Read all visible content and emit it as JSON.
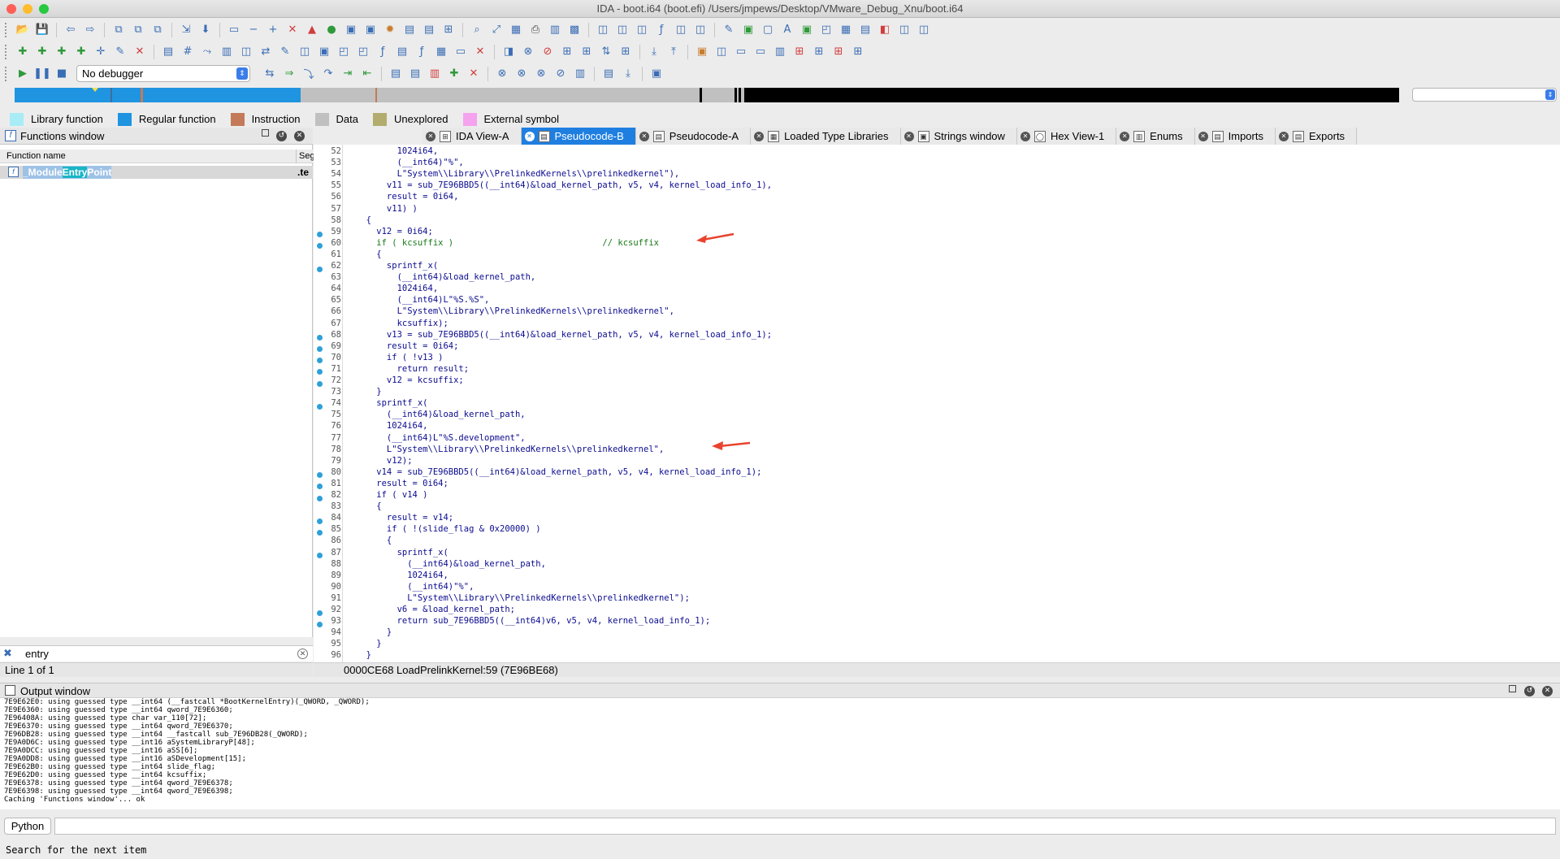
{
  "window": {
    "title": "IDA - boot.i64 (boot.efi) /Users/jmpews/Desktop/VMware_Debug_Xnu/boot.i64"
  },
  "debugger": {
    "selected": "No debugger"
  },
  "legend": [
    {
      "label": "Library function",
      "color": "#a8ecf6"
    },
    {
      "label": "Regular function",
      "color": "#1f94e0"
    },
    {
      "label": "Instruction",
      "color": "#c47a58"
    },
    {
      "label": "Data",
      "color": "#c0c0c0"
    },
    {
      "label": "Unexplored",
      "color": "#b2ad6e"
    },
    {
      "label": "External symbol",
      "color": "#f5a2ef"
    }
  ],
  "functions_window": {
    "title": "Functions window",
    "col_name": "Function name",
    "col_seg": "Seg",
    "rows": [
      {
        "name_pre": "_Module",
        "name_hl": "Entry",
        "name_post": "Point",
        "seg": ".te"
      }
    ],
    "filter_value": "entry",
    "status": "Line 1 of 1"
  },
  "tabs": [
    {
      "label": "IDA View-A",
      "icon": "graph-icon",
      "active": false
    },
    {
      "label": "Pseudocode-B",
      "icon": "pseudocode-icon",
      "active": true
    },
    {
      "label": "Pseudocode-A",
      "icon": "pseudocode-icon",
      "active": false
    },
    {
      "label": "Loaded Type Libraries",
      "icon": "library-icon",
      "active": false
    },
    {
      "label": "Strings window",
      "icon": "strings-icon",
      "active": false
    },
    {
      "label": "Hex View-1",
      "icon": "hex-icon",
      "active": false
    },
    {
      "label": "Enums",
      "icon": "enum-icon",
      "active": false
    },
    {
      "label": "Imports",
      "icon": "imports-icon",
      "active": false
    },
    {
      "label": "Exports",
      "icon": "exports-icon",
      "active": false
    }
  ],
  "code_lines": [
    {
      "n": "52",
      "bp": false,
      "t": "        1024i64,"
    },
    {
      "n": "53",
      "bp": false,
      "t": "        (__int64)\"%\","
    },
    {
      "n": "54",
      "bp": false,
      "t": "        L\"System\\\\Library\\\\PrelinkedKernels\\\\prelinkedkernel\"),"
    },
    {
      "n": "55",
      "bp": false,
      "t": "      v11 = sub_7E96BBD5((__int64)&load_kernel_path, v5, v4, kernel_load_info_1),"
    },
    {
      "n": "56",
      "bp": false,
      "t": "      result = 0i64,"
    },
    {
      "n": "57",
      "bp": false,
      "t": "      v11) )"
    },
    {
      "n": "58",
      "bp": false,
      "t": "  {"
    },
    {
      "n": "59",
      "bp": true,
      "t": "    v12 = 0i64;"
    },
    {
      "n": "60",
      "bp": true,
      "t": "    if ( kcsuffix )                             // kcsuffix"
    },
    {
      "n": "61",
      "bp": false,
      "t": "    {"
    },
    {
      "n": "62",
      "bp": true,
      "t": "      sprintf_x("
    },
    {
      "n": "63",
      "bp": false,
      "t": "        (__int64)&load_kernel_path,"
    },
    {
      "n": "64",
      "bp": false,
      "t": "        1024i64,"
    },
    {
      "n": "65",
      "bp": false,
      "t": "        (__int64)L\"%S.%S\","
    },
    {
      "n": "66",
      "bp": false,
      "t": "        L\"System\\\\Library\\\\PrelinkedKernels\\\\prelinkedkernel\","
    },
    {
      "n": "67",
      "bp": false,
      "t": "        kcsuffix);"
    },
    {
      "n": "68",
      "bp": true,
      "t": "      v13 = sub_7E96BBD5((__int64)&load_kernel_path, v5, v4, kernel_load_info_1);"
    },
    {
      "n": "69",
      "bp": true,
      "t": "      result = 0i64;"
    },
    {
      "n": "70",
      "bp": true,
      "t": "      if ( !v13 )"
    },
    {
      "n": "71",
      "bp": true,
      "t": "        return result;"
    },
    {
      "n": "72",
      "bp": true,
      "t": "      v12 = kcsuffix;"
    },
    {
      "n": "73",
      "bp": false,
      "t": "    }"
    },
    {
      "n": "74",
      "bp": true,
      "t": "    sprintf_x("
    },
    {
      "n": "75",
      "bp": false,
      "t": "      (__int64)&load_kernel_path,"
    },
    {
      "n": "76",
      "bp": false,
      "t": "      1024i64,"
    },
    {
      "n": "77",
      "bp": false,
      "t": "      (__int64)L\"%S.development\","
    },
    {
      "n": "78",
      "bp": false,
      "t": "      L\"System\\\\Library\\\\PrelinkedKernels\\\\prelinkedkernel\","
    },
    {
      "n": "79",
      "bp": false,
      "t": "      v12);"
    },
    {
      "n": "80",
      "bp": true,
      "t": "    v14 = sub_7E96BBD5((__int64)&load_kernel_path, v5, v4, kernel_load_info_1);"
    },
    {
      "n": "81",
      "bp": true,
      "t": "    result = 0i64;"
    },
    {
      "n": "82",
      "bp": true,
      "t": "    if ( v14 )"
    },
    {
      "n": "83",
      "bp": false,
      "t": "    {"
    },
    {
      "n": "84",
      "bp": true,
      "t": "      result = v14;"
    },
    {
      "n": "85",
      "bp": true,
      "t": "      if ( !(slide_flag & 0x20000) )"
    },
    {
      "n": "86",
      "bp": false,
      "t": "      {"
    },
    {
      "n": "87",
      "bp": true,
      "t": "        sprintf_x("
    },
    {
      "n": "88",
      "bp": false,
      "t": "          (__int64)&load_kernel_path,"
    },
    {
      "n": "89",
      "bp": false,
      "t": "          1024i64,"
    },
    {
      "n": "90",
      "bp": false,
      "t": "          (__int64)\"%\","
    },
    {
      "n": "91",
      "bp": false,
      "t": "          L\"System\\\\Library\\\\PrelinkedKernels\\\\prelinkedkernel\");"
    },
    {
      "n": "92",
      "bp": true,
      "t": "        v6 = &load_kernel_path;"
    },
    {
      "n": "93",
      "bp": true,
      "t": "        return sub_7E96BBD5((__int64)v6, v5, v4, kernel_load_info_1);"
    },
    {
      "n": "94",
      "bp": false,
      "t": "      }"
    },
    {
      "n": "95",
      "bp": false,
      "t": "    }"
    },
    {
      "n": "96",
      "bp": false,
      "t": "  }"
    }
  ],
  "code_status": "0000CE68  LoadPrelinkKernel:59 (7E96BE68)",
  "output_window": {
    "title": "Output window",
    "lines": [
      "7E9E62E0: using guessed type __int64 (__fastcall *BootKernelEntry)(_QWORD, _QWORD);",
      "7E9E6360: using guessed type __int64 qword_7E9E6360;",
      "7E96408A: using guessed type char var_110[72];",
      "7E9E6370: using guessed type __int64 qword_7E9E6370;",
      "7E96DB28: using guessed type __int64 __fastcall sub_7E96DB28(_QWORD);",
      "7E9A0D6C: using guessed type __int16 aSystemLibraryP[48];",
      "7E9A0DCC: using guessed type __int16 aSS[6];",
      "7E9A0DD8: using guessed type __int16 aSDevelopment[15];",
      "7E9E62B0: using guessed type __int64 slide_flag;",
      "7E9E62D0: using guessed type __int64 kcsuffix;",
      "7E9E6378: using guessed type __int64 qword_7E9E6378;",
      "7E9E6398: using guessed type __int64 qword_7E9E6398;",
      "Caching 'Functions window'... ok"
    ]
  },
  "python_button": "Python",
  "bottom_status": "Search for the next item"
}
